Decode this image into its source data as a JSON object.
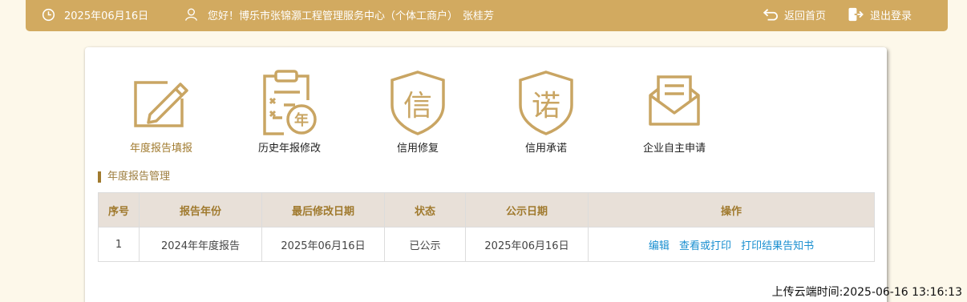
{
  "header": {
    "date": "2025年06月16日",
    "greeting": "您好！博乐市张锦灏工程管理服务中心（个体工商户）",
    "user_name": "张桂芳",
    "back_home_label": "返回首页",
    "logout_label": "退出登录",
    "icons": [
      "clock-icon",
      "user-icon",
      "return-icon",
      "logout-icon"
    ]
  },
  "nav": {
    "items": [
      {
        "label": "年度报告填报",
        "icon": "annual-report-edit-icon",
        "active": true
      },
      {
        "label": "历史年报修改",
        "icon": "history-report-icon",
        "active": false
      },
      {
        "label": "信用修复",
        "icon": "credit-repair-icon",
        "active": false
      },
      {
        "label": "信用承诺",
        "icon": "credit-promise-icon",
        "active": false
      },
      {
        "label": "企业自主申请",
        "icon": "envelope-apply-icon",
        "active": false
      }
    ]
  },
  "section": {
    "title": "年度报告管理"
  },
  "table": {
    "headers": [
      "序号",
      "报告年份",
      "最后修改日期",
      "状态",
      "公示日期",
      "操作"
    ],
    "rows": [
      {
        "index": "1",
        "report_year": "2024年年度报告",
        "last_modified": "2025年06月16日",
        "status": "已公示",
        "publish_date": "2025年06月16日",
        "actions": [
          "编辑",
          "查看或打印",
          "打印结果告知书"
        ]
      }
    ]
  },
  "footer": {
    "upload_time": "上传云端时间:2025-06-16 13:16:13"
  },
  "colors": {
    "header_bg": "#d2aa60",
    "gold_icon": "#c9a563",
    "accent_text": "#a07a2e",
    "link": "#1a8fd0",
    "table_header_bg": "#e8e0d8",
    "page_bg": "#fdf8ea"
  }
}
